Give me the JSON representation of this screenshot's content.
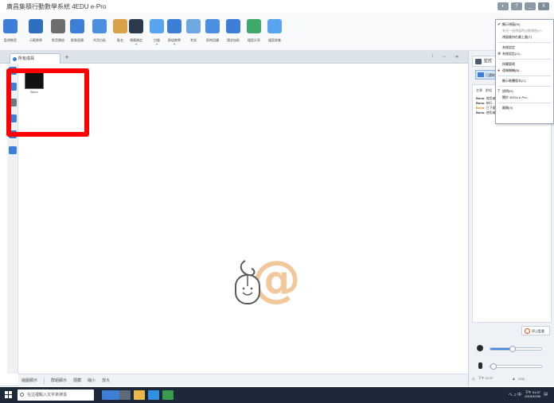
{
  "window": {
    "title": "廣昌集積行動數學系統 4EDU e-Pro",
    "controls": [
      "◐",
      "?",
      "_",
      "X"
    ]
  },
  "toolbar": {
    "items": [
      {
        "label": "監視教室",
        "icon": "monitor-icon",
        "color": "#3d7fd6",
        "has_menu": false
      },
      {
        "label": "示範教學",
        "icon": "teacher-icon",
        "color": "#2f6fc2",
        "has_menu": false
      },
      {
        "label": "影音播放",
        "icon": "film-reel-icon",
        "color": "#6d6d6d",
        "has_menu": false
      },
      {
        "label": "影像直播",
        "icon": "webcam-icon",
        "color": "#3d7fd6",
        "has_menu": false
      },
      {
        "label": "共用白板",
        "icon": "whiteboard-icon",
        "color": "#4a8fe0",
        "has_menu": false
      },
      {
        "label": "點名",
        "icon": "roll-call-icon",
        "color": "#d9a14a",
        "has_menu": false
      },
      {
        "label": "螢幕鎖定",
        "icon": "screen-lock-icon",
        "color": "#2b3a4d",
        "has_menu": true
      },
      {
        "label": "討論",
        "icon": "chat-bubble-icon",
        "color": "#58a4ee",
        "has_menu": true
      },
      {
        "label": "群組教學",
        "icon": "group-icon",
        "color": "#3d7fd6",
        "has_menu": true
      },
      {
        "label": "考試",
        "icon": "quiz-icon",
        "color": "#6fa8e0",
        "has_menu": false
      },
      {
        "label": "即時回饋",
        "icon": "feedback-icon",
        "color": "#4a8fe0",
        "has_menu": false
      },
      {
        "label": "請求協助",
        "icon": "help-request-icon",
        "color": "#3d7fd6",
        "has_menu": false
      },
      {
        "label": "檔案分享",
        "icon": "file-share-icon",
        "color": "#3fa86b",
        "has_menu": false
      },
      {
        "label": "檔案收集",
        "icon": "file-collect-icon",
        "color": "#58a4ee",
        "has_menu": false
      }
    ]
  },
  "tabs": {
    "active_label": "所有成員",
    "add_label": "+",
    "right_icons": [
      "↕",
      "↔",
      "➜"
    ]
  },
  "sidebar": {
    "icons": [
      {
        "name": "list-view-icon",
        "color": "#3d7fd6"
      },
      {
        "name": "user-icon",
        "color": "#3d7fd6"
      },
      {
        "name": "page-icon",
        "color": "#6d7a88"
      },
      {
        "name": "screen-icon",
        "color": "#3d7fd6"
      },
      {
        "name": "person-icon",
        "color": "#3d7fd6"
      },
      {
        "name": "edit-icon",
        "color": "#3d7fd6"
      }
    ]
  },
  "canvas": {
    "thumbnail_label": "Bono"
  },
  "statusbar": {
    "items": [
      "縮圖顯示",
      "群組顯示",
      "隱藏",
      "縮小",
      "放大"
    ]
  },
  "right_panel": {
    "header": "監控",
    "selected": "已選取",
    "list_header": [
      "名單",
      "群組"
    ],
    "rows": [
      {
        "name": "Bono:",
        "text": "使用者…",
        "style": "normal"
      },
      {
        "name": "Bono:",
        "text": "執行…",
        "style": "normal"
      },
      {
        "name": "Bono:",
        "text": "已下載…",
        "style": "orange"
      },
      {
        "name": "Bono:",
        "text": "使用者…",
        "style": "normal"
      }
    ],
    "stop_button": "停止監看",
    "speaker_level": 0.42,
    "mic_level": 0.0,
    "footer_time": "下午 01:37",
    "footer_count": "0/30"
  },
  "context_menu": {
    "items": [
      {
        "label": "顯示視窗(W)",
        "mark": "✔",
        "mark_color": "dark",
        "muted": false
      },
      {
        "label": "有另一個視窗時自動開啟(H)",
        "mark": "",
        "mark_color": "",
        "muted": true
      },
      {
        "label": "視窗維持在最上層(T)",
        "mark": "",
        "mark_color": "",
        "muted": false
      },
      {
        "sep": true
      },
      {
        "label": "系統設定",
        "mark": "",
        "mark_color": "",
        "muted": false
      },
      {
        "label": "系統設定(O)...",
        "mark": "⚙",
        "mark_color": "dark",
        "muted": false
      },
      {
        "sep": true
      },
      {
        "label": "授權管理",
        "mark": "",
        "mark_color": "",
        "muted": false
      },
      {
        "label": "遠端開機(B)...",
        "mark": "●",
        "mark_color": "red",
        "muted": false
      },
      {
        "sep": true
      },
      {
        "label": "顯示軟體版本(C)",
        "mark": "",
        "mark_color": "",
        "muted": false
      },
      {
        "sep": true
      },
      {
        "label": "說明(H)",
        "mark": "?",
        "mark_color": "dark",
        "muted": false
      },
      {
        "label": "關於 4EDU e-Pro...",
        "mark": "",
        "mark_color": "",
        "muted": false
      },
      {
        "sep": true
      },
      {
        "label": "離開(X)",
        "mark": "",
        "mark_color": "",
        "muted": false
      }
    ]
  },
  "taskbar": {
    "search_placeholder": "在這裡輸入文字來搜尋",
    "apps": [
      {
        "name": "edu-app-taskbar-icon",
        "color": "#3d7fd6"
      },
      {
        "name": "task-view-icon",
        "color": "#5c6a7a"
      },
      {
        "name": "file-explorer-icon",
        "color": "#e8b84a"
      },
      {
        "name": "browser-icon",
        "color": "#2f8fe0"
      },
      {
        "name": "store-icon",
        "color": "#3a9a4f"
      }
    ],
    "tray": "へ ♫ 中",
    "time": "下午 01:37",
    "date": "2019/10/30"
  },
  "highlight": {
    "color": "#ff0000"
  }
}
